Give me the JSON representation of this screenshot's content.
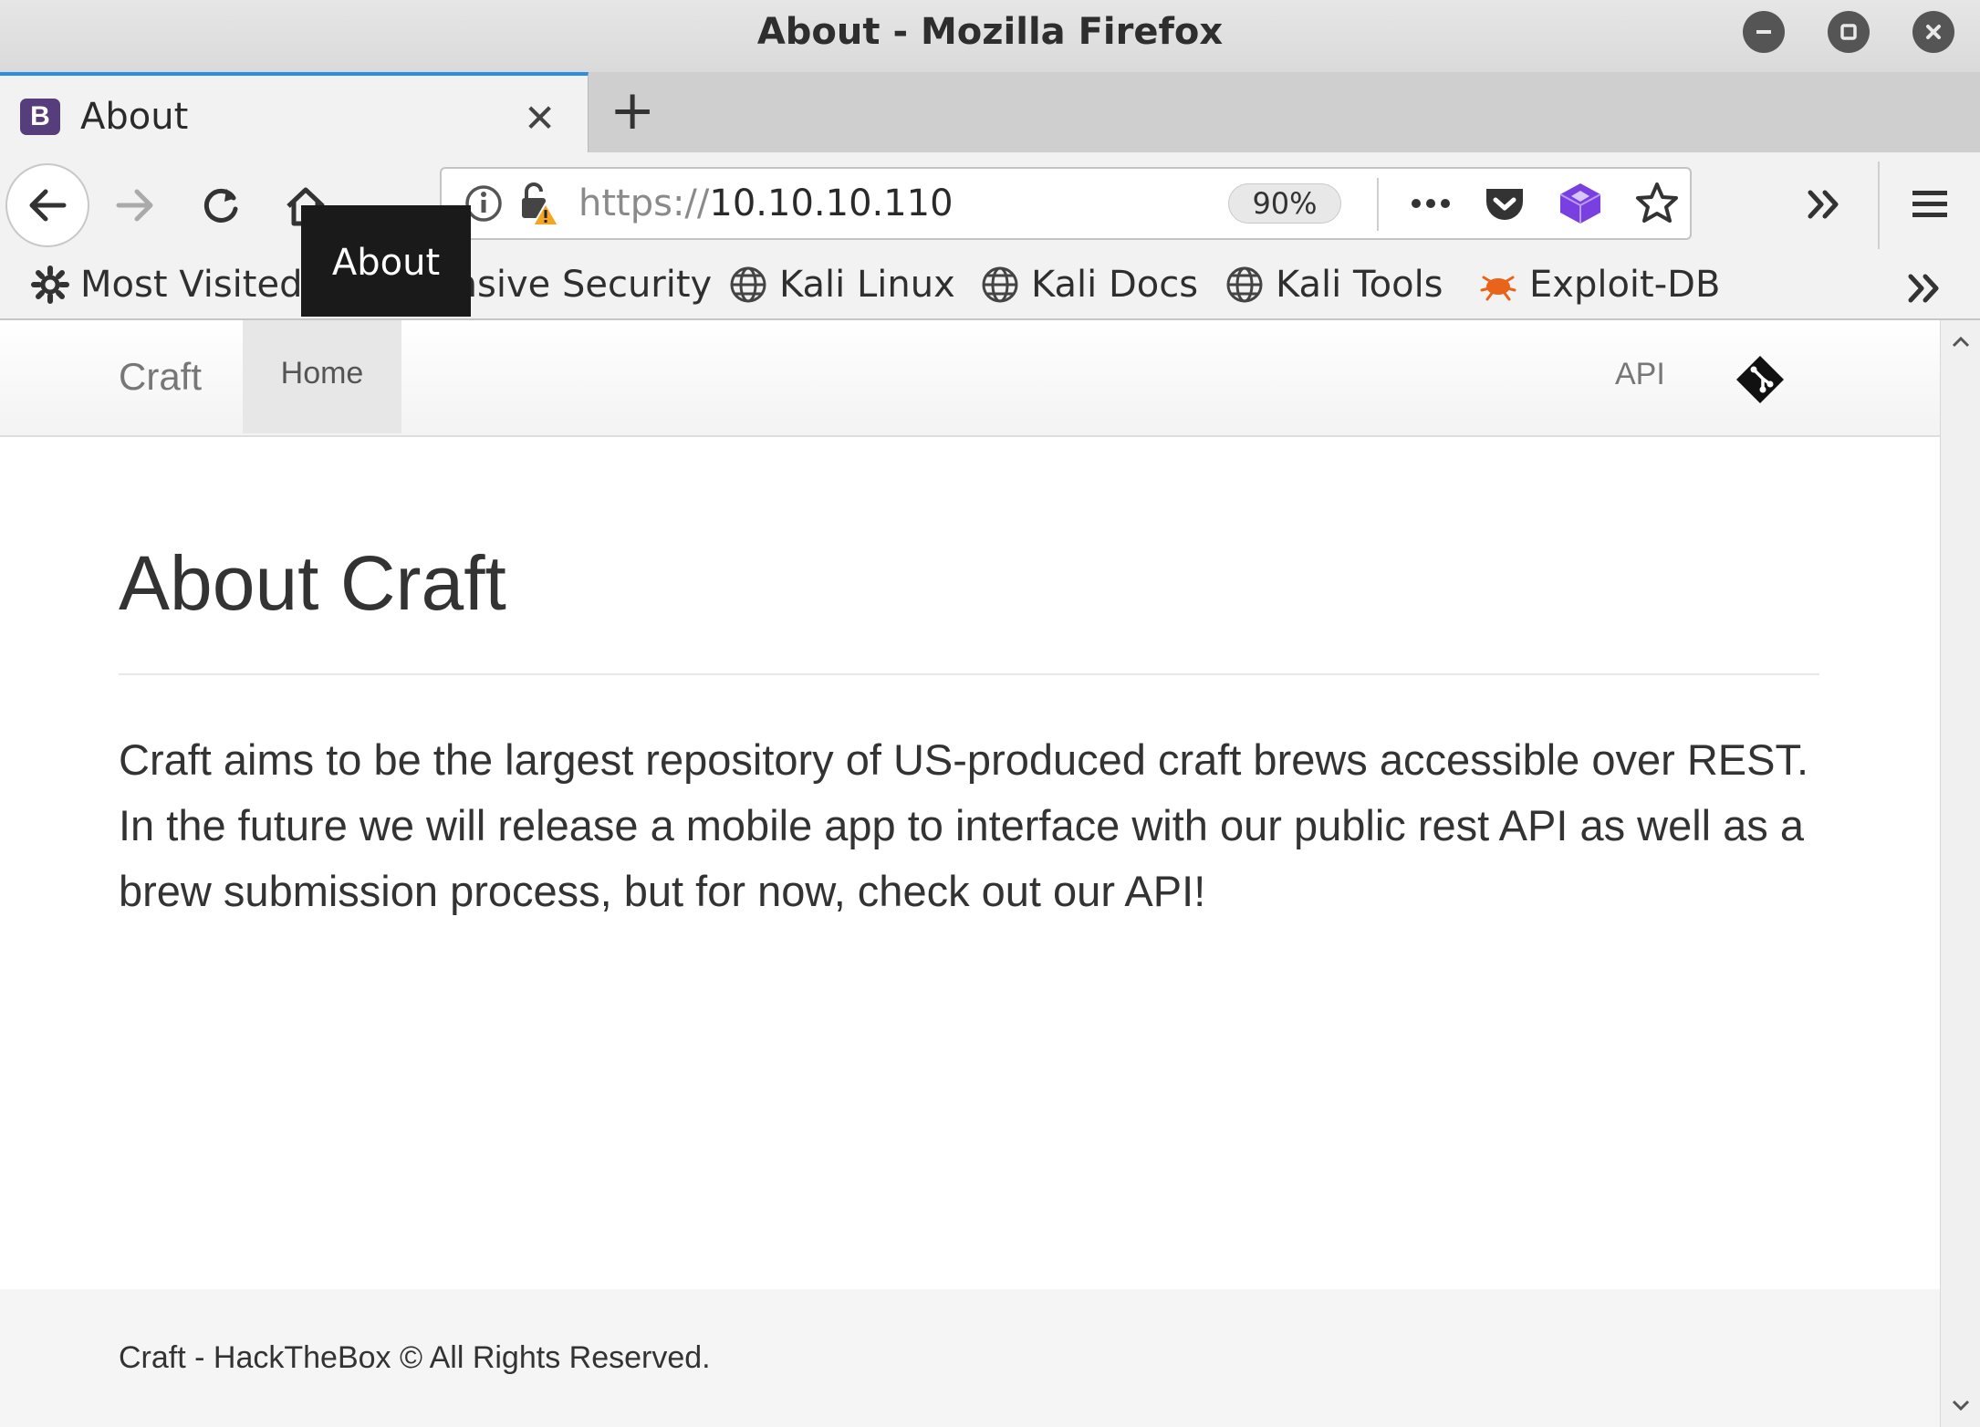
{
  "window": {
    "title": "About - Mozilla Firefox"
  },
  "tabs": [
    {
      "label": "About",
      "favicon": "B"
    }
  ],
  "toolbar": {
    "url_scheme": "https://",
    "url_host": "10.10.10.110",
    "zoom": "90%"
  },
  "tooltip": "About",
  "bookmarks": [
    {
      "label": "Most Visited",
      "icon": "gear-icon"
    },
    {
      "label": "Offensive Security",
      "icon": "globe-icon"
    },
    {
      "label": "Kali Linux",
      "icon": "globe-icon"
    },
    {
      "label": "Kali Docs",
      "icon": "globe-icon"
    },
    {
      "label": "Kali Tools",
      "icon": "globe-icon"
    },
    {
      "label": "Exploit-DB",
      "icon": "exploitdb-icon"
    }
  ],
  "site": {
    "brand": "Craft",
    "nav_home": "Home",
    "nav_api": "API",
    "heading": "About Craft",
    "body": "Craft aims to be the largest repository of US-produced craft brews accessible over REST. In the future we will release a mobile app to interface with our public rest API as well as a brew submission process, but for now, check out our API!",
    "footer": "Craft - HackTheBox © All Rights Reserved."
  },
  "colors": {
    "tab_accent": "#2b8ee0",
    "favicon_bg": "#563d7c",
    "extension_purple": "#7a3fe0",
    "warning": "#f4a623",
    "exploitdb_orange": "#e8641a"
  }
}
